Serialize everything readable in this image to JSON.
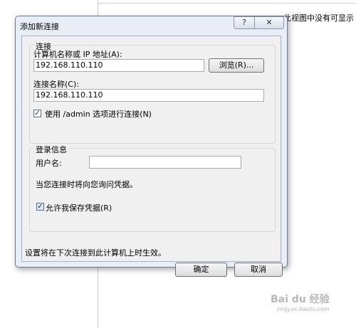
{
  "background": {
    "visible_text": "此视图中没有可显示"
  },
  "dialog": {
    "title": "添加新连接",
    "help_glyph": "?",
    "close_glyph": "✕",
    "connection_group": {
      "legend": "连接",
      "computer_label": "计算机名称或 IP 地址(A):",
      "computer_value": "192.168.110.110",
      "browse_label": "浏览(R)...",
      "name_label": "连接名称(C):",
      "name_value": "192.168.110.110",
      "admin_label": "使用 /admin 选项进行连接(N)",
      "admin_checked": true
    },
    "login_group": {
      "legend": "登录信息",
      "username_label": "用户名:",
      "username_value": "",
      "prompt_text": "当您连接时将向您询问凭据。",
      "save_label": "允许我保存凭据(R)",
      "save_checked": true
    },
    "footer_text": "设置将在下次连接到此计算机上时生效。",
    "ok_label": "确定",
    "cancel_label": "取消"
  },
  "watermark": {
    "brand": "Bai du 经验",
    "url": "jingyan.baidu.com"
  }
}
